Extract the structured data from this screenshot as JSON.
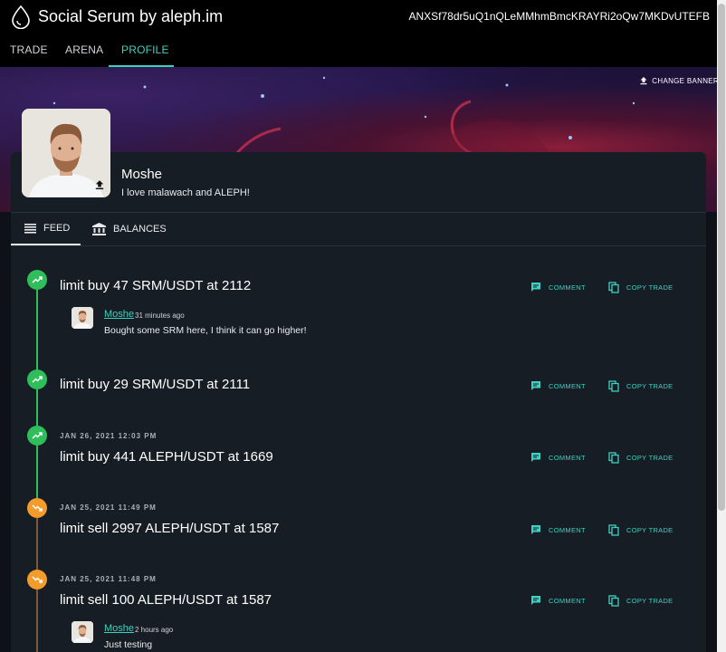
{
  "header": {
    "app_title": "Social Serum by aleph.im",
    "wallet_address": "ANXSf78dr5uQ1nQLeMMhmBmcKRAYRi2oQw7MKDvUTEFB"
  },
  "nav": {
    "tabs": [
      {
        "label": "TRADE"
      },
      {
        "label": "ARENA"
      },
      {
        "label": "PROFILE"
      }
    ],
    "active": "PROFILE"
  },
  "banner": {
    "change_banner_label": "CHANGE BANNER"
  },
  "profile": {
    "name": "Moshe",
    "bio": "I love malawach and ALEPH!"
  },
  "profile_tabs": [
    {
      "label": "FEED",
      "icon": "list-icon"
    },
    {
      "label": "BALANCES",
      "icon": "bank-icon"
    }
  ],
  "actions": {
    "comment": "COMMENT",
    "copy_trade": "COPY TRADE"
  },
  "feed": [
    {
      "direction": "up",
      "date": "",
      "title": "limit buy 47 SRM/USDT at 2112",
      "comments": [
        {
          "author": "Moshe",
          "time": "31 minutes ago",
          "text": "Bought some SRM here, I think it can go higher!"
        }
      ]
    },
    {
      "direction": "up",
      "date": "",
      "title": "limit buy 29 SRM/USDT at 2111",
      "comments": []
    },
    {
      "direction": "up",
      "date": "JAN 26, 2021 12:03 PM",
      "title": "limit buy 441 ALEPH/USDT at 1669",
      "comments": []
    },
    {
      "direction": "down",
      "date": "JAN 25, 2021 11:49 PM",
      "title": "limit sell 2997 ALEPH/USDT at 1587",
      "comments": []
    },
    {
      "direction": "down",
      "date": "JAN 25, 2021 11:48 PM",
      "title": "limit sell 100 ALEPH/USDT at 1587",
      "comments": [
        {
          "author": "Moshe",
          "time": "2 hours ago",
          "text": "Just testing"
        }
      ]
    }
  ],
  "colors": {
    "accent": "#3fd0c0",
    "buy": "#2fbf5a",
    "sell": "#f39c2b",
    "background": "#0e1218",
    "card": "#171d24"
  }
}
